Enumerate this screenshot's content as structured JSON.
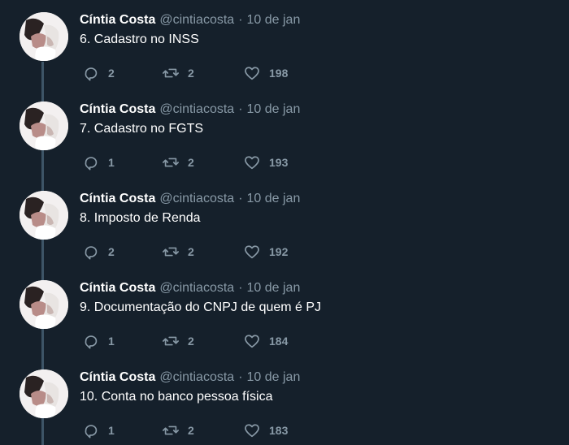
{
  "thread": {
    "tweets": [
      {
        "name": "Cíntia Costa",
        "handle": "@cintiacosta",
        "separator": "·",
        "date": "10 de jan",
        "text": "6. Cadastro no INSS",
        "replies": "2",
        "retweets": "2",
        "likes": "198"
      },
      {
        "name": "Cíntia Costa",
        "handle": "@cintiacosta",
        "separator": "·",
        "date": "10 de jan",
        "text": "7. Cadastro no FGTS",
        "replies": "1",
        "retweets": "2",
        "likes": "193"
      },
      {
        "name": "Cíntia Costa",
        "handle": "@cintiacosta",
        "separator": "·",
        "date": "10 de jan",
        "text": "8. Imposto de Renda",
        "replies": "2",
        "retweets": "2",
        "likes": "192"
      },
      {
        "name": "Cíntia Costa",
        "handle": "@cintiacosta",
        "separator": "·",
        "date": "10 de jan",
        "text": "9. Documentação do CNPJ de quem é PJ",
        "replies": "1",
        "retweets": "2",
        "likes": "184"
      },
      {
        "name": "Cíntia Costa",
        "handle": "@cintiacosta",
        "separator": "·",
        "date": "10 de jan",
        "text": "10. Conta no banco pessoa física",
        "replies": "1",
        "retweets": "2",
        "likes": "183"
      }
    ]
  },
  "icons": {
    "reply": "reply-icon",
    "retweet": "retweet-icon",
    "like": "heart-icon"
  },
  "colors": {
    "background": "#15202b",
    "primary_text": "#ffffff",
    "secondary_text": "#8899a6",
    "thread_line": "#3d5466"
  }
}
